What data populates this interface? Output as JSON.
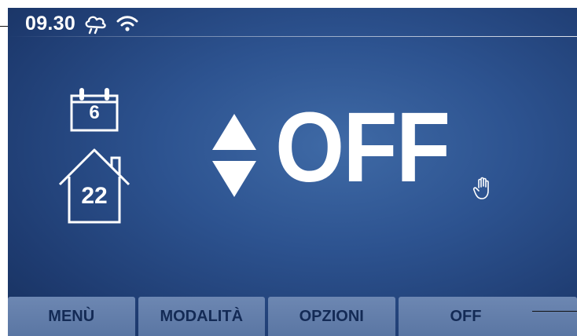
{
  "status_bar": {
    "time": "09.30",
    "weather_icon": "rain-cloud-icon",
    "connectivity_icon": "wifi-icon"
  },
  "schedule": {
    "icon": "calendar-icon",
    "day_number": "6"
  },
  "home": {
    "icon": "house-icon",
    "temperature": "22"
  },
  "main": {
    "adjust_icon": "up-down-arrows-icon",
    "value": "OFF",
    "manual_icon": "hand-icon"
  },
  "bottom_bar": {
    "tabs": [
      {
        "label": "MENÙ"
      },
      {
        "label": "MODALITÀ"
      },
      {
        "label": "OPZIONI"
      },
      {
        "label": "OFF"
      }
    ]
  },
  "colors": {
    "background": "#2d5390",
    "tab_background": "#6d87b2",
    "tab_text": "#132a55",
    "foreground": "#ffffff"
  }
}
